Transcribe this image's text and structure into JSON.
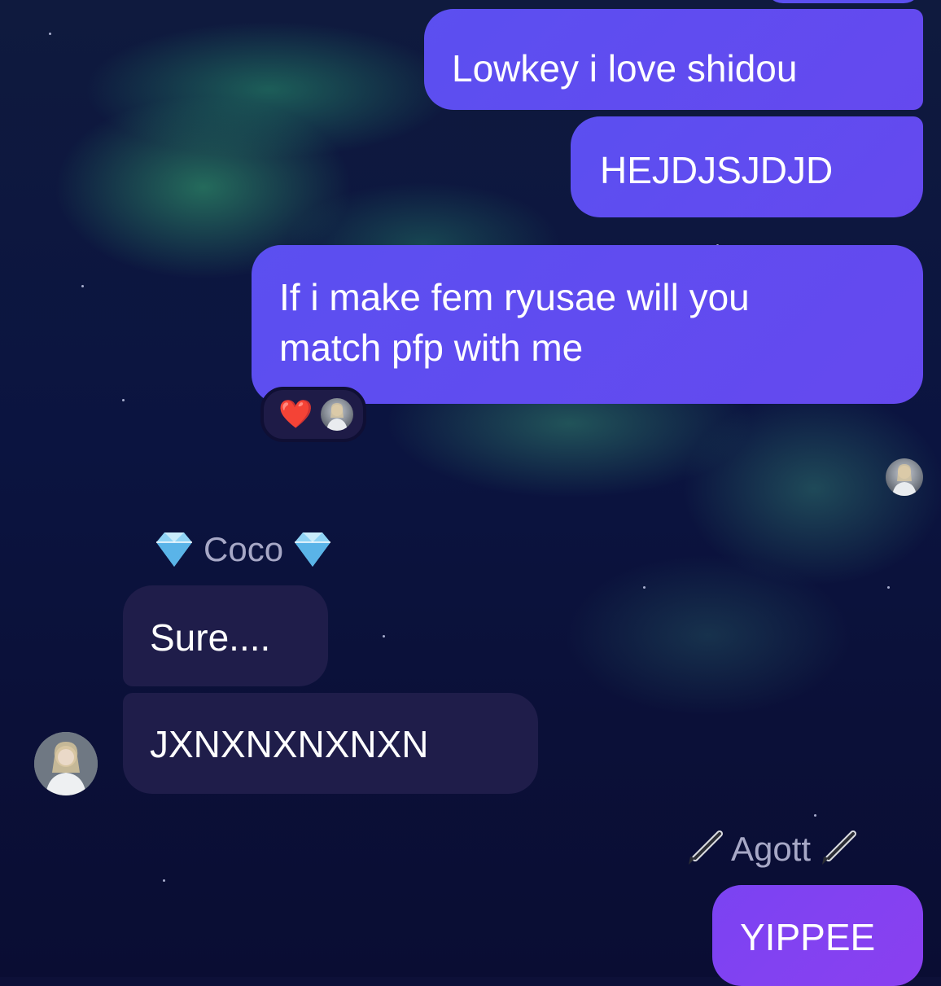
{
  "messages": [
    {
      "id": "m1",
      "direction": "outgoing",
      "text": "Lowkey i love shidou"
    },
    {
      "id": "m2",
      "direction": "outgoing",
      "text": "HEJDJSJDJD"
    },
    {
      "id": "m3",
      "direction": "outgoing",
      "text_lines": [
        "If i make fem ryusae will you",
        "match pfp with me"
      ],
      "reaction": "❤️"
    },
    {
      "id": "m4",
      "direction": "incoming",
      "sender": "Coco",
      "text": "Sure...."
    },
    {
      "id": "m5",
      "direction": "incoming",
      "sender": "Coco",
      "text": "JXNXNXNXNXN"
    },
    {
      "id": "m6",
      "direction": "outgoing",
      "sender": "Agott",
      "text": "YIPPEE"
    }
  ],
  "senders": {
    "coco": {
      "name": "Coco",
      "decoration_icon": "gem-icon"
    },
    "agott": {
      "name": "Agott",
      "decoration_icon": "pen-icon"
    }
  },
  "reaction": {
    "emoji": "❤️"
  },
  "colors": {
    "outgoing_bubble": "#5b4ff0",
    "outgoing_bubble_last": "#7b43f2",
    "incoming_bubble": "#1f1d4a",
    "background": "#0d1038",
    "name_label": "#a7a8c6"
  }
}
